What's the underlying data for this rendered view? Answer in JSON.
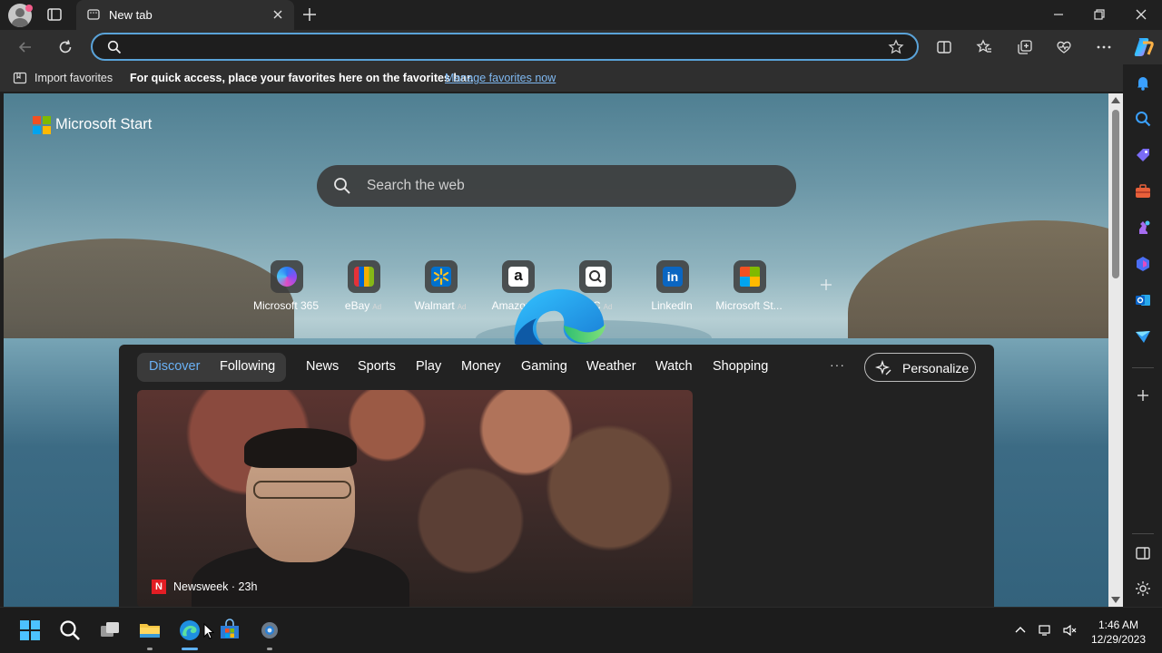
{
  "tab": {
    "title": "New tab"
  },
  "omnibox": {
    "value": "",
    "placeholder": ""
  },
  "favorites_bar": {
    "import_label": "Import favorites",
    "hint": "For quick access, place your favorites here on the favorites bar.",
    "manage_link": "Manage favorites now"
  },
  "page": {
    "brand": "Microsoft Start",
    "search_placeholder": "Search the web",
    "ad_badge": "Ad",
    "quick_links": [
      {
        "label": "Microsoft 365",
        "ad": false,
        "icon": "microsoft-365-icon"
      },
      {
        "label": "eBay",
        "ad": true,
        "icon": "ebay-icon"
      },
      {
        "label": "Walmart",
        "ad": true,
        "icon": "walmart-icon"
      },
      {
        "label": "Amazon",
        "ad": true,
        "icon": "amazon-icon"
      },
      {
        "label": "QVC",
        "ad": true,
        "icon": "qvc-icon"
      },
      {
        "label": "LinkedIn",
        "ad": false,
        "icon": "linkedin-icon"
      },
      {
        "label": "Microsoft St...",
        "ad": false,
        "icon": "microsoft-store-icon"
      }
    ]
  },
  "feed": {
    "tabs": [
      "Discover",
      "Following",
      "News",
      "Sports",
      "Play",
      "Money",
      "Gaming",
      "Weather",
      "Watch",
      "Shopping"
    ],
    "active_tab": "Discover",
    "more": "···",
    "personalize": "Personalize",
    "card": {
      "source_logo": "N",
      "source": "Newsweek · 23h"
    }
  },
  "taskbar": {
    "time": "1:46 AM",
    "date": "12/29/2023"
  },
  "colors": {
    "accent": "#5aa3d9",
    "active_tab": "#6ab1f5",
    "ad_text": "#d8d8d8"
  }
}
